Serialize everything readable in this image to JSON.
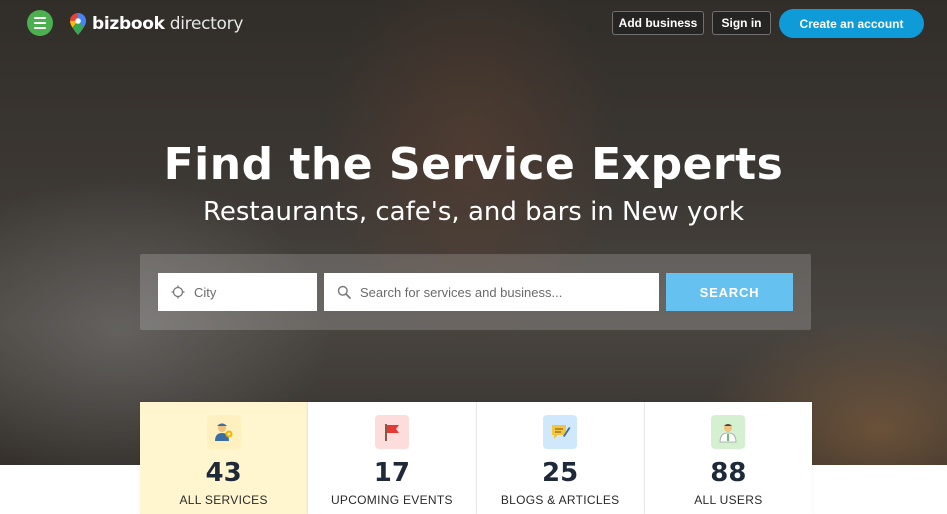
{
  "header": {
    "logo_brand": "bizbook",
    "logo_suffix": "directory",
    "add_business": "Add business",
    "sign_in": "Sign in",
    "create_account": "Create an account"
  },
  "hero": {
    "title": "Find the Service Experts",
    "subtitle": "Restaurants, cafe's, and bars in New york"
  },
  "search": {
    "city_placeholder": "City",
    "query_placeholder": "Search for services and business...",
    "button_label": "SEARCH"
  },
  "stats": [
    {
      "value": "43",
      "label": "ALL SERVICES",
      "icon": "worker-icon",
      "icon_bg": "#fff0c0"
    },
    {
      "value": "17",
      "label": "UPCOMING EVENTS",
      "icon": "flag-icon",
      "icon_bg": "#fddcdc"
    },
    {
      "value": "25",
      "label": "BLOGS & ARTICLES",
      "icon": "note-icon",
      "icon_bg": "#cfe8fb"
    },
    {
      "value": "88",
      "label": "ALL USERS",
      "icon": "user-icon",
      "icon_bg": "#d4f0d0"
    }
  ],
  "colors": {
    "menu_green": "#4caf50",
    "create_blue": "#0f9bd7",
    "search_blue": "#64c1f0",
    "active_stat_bg": "#fff5cf"
  }
}
